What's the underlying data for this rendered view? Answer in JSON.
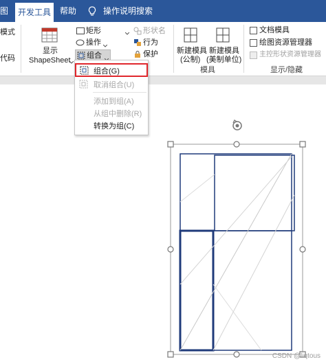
{
  "tabs": [
    {
      "label": "图"
    },
    {
      "label": "开发工具"
    },
    {
      "label": "帮助"
    },
    {
      "label": "操作说明搜索"
    }
  ],
  "ribbon": {
    "left_cut": [
      "模式",
      "代码"
    ],
    "show_shapesheet": {
      "line1": "显示",
      "line2": "ShapeSheet"
    },
    "rectangle": "矩形",
    "operation": "操作",
    "group": "组合",
    "shape_name": "形状名",
    "behavior": "行为",
    "protect": "保护",
    "new_stencil_metric": {
      "line1": "新建模具",
      "line2": "(公制)"
    },
    "new_stencil_us": {
      "line1": "新建模具",
      "line2": "(美制单位)"
    },
    "stencil_group_label": "模具",
    "doc_stencil": "文档模具",
    "drawing_explorer": "绘图资源管理器",
    "master_explorer": "主控形状资源管理器",
    "show_hide_label": "显示/隐藏"
  },
  "menu": {
    "items": [
      {
        "label": "组合(G)",
        "enabled": true
      },
      {
        "label": "取消组合(U)",
        "enabled": false
      },
      {
        "label": "添加到组(A)",
        "enabled": false
      },
      {
        "label": "从组中删除(R)",
        "enabled": false
      },
      {
        "label": "转换为组(C)",
        "enabled": true
      }
    ]
  },
  "watermark": "CSDN @liqtous",
  "colors": {
    "tabbar": "#2b579a",
    "shape_stroke": "#1f3a7a",
    "selected_outline": "#e0262b"
  }
}
